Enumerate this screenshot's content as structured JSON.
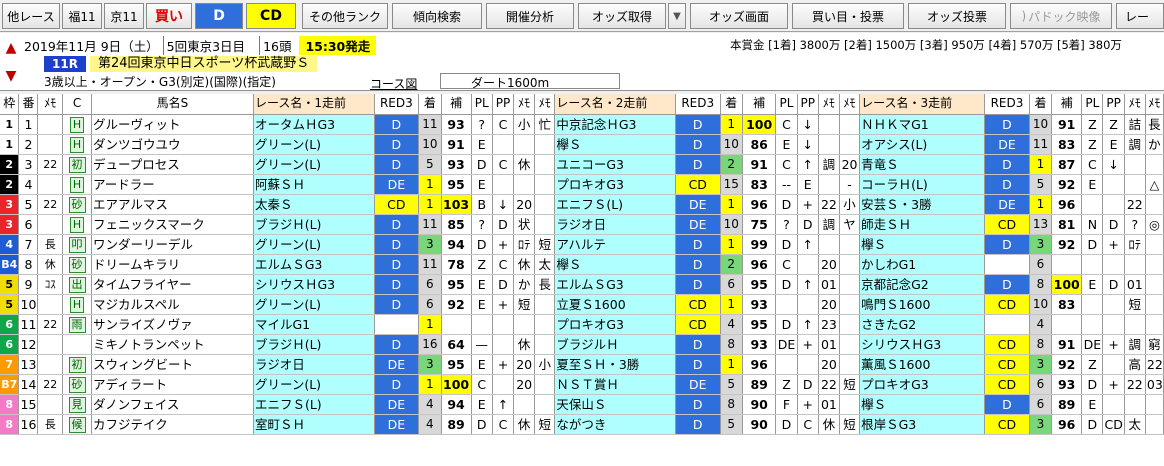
{
  "toolbar": {
    "items": [
      {
        "label": "他レース"
      },
      {
        "label": "福11"
      },
      {
        "label": "京11"
      },
      {
        "label": "買い"
      },
      {
        "label": "D"
      },
      {
        "label": "CD"
      },
      {
        "label": "その他ランク"
      },
      {
        "label": "傾向検索"
      },
      {
        "label": "開催分析"
      },
      {
        "label": "オッズ取得"
      },
      {
        "label": "▼"
      },
      {
        "label": "オッズ画面"
      },
      {
        "label": "買い目・投票"
      },
      {
        "label": "オッズ投票"
      },
      {
        "label": "パドック映像"
      },
      {
        "label": "レー"
      }
    ]
  },
  "race": {
    "date": "2019年11月 9日（土）",
    "meeting": "5回東京3日目",
    "heads": "16頭",
    "start": "15:30発走",
    "number": "11R",
    "title": "第24回東京中日スポーツ杯武蔵野Ｓ",
    "conditions": "3歳以上・オープン・G3(別定)(国際)(指定)",
    "course_label": "コース図",
    "course": "ダート1600m",
    "prize": "本賞金 [1着] 3800万 [2着] 1500万 [3着] 950万 [4着] 570万 [5着] 380万"
  },
  "headers": [
    "枠",
    "番",
    "ﾒﾓ",
    "C",
    "馬名S",
    "レース名・1走前",
    "RED3",
    "着",
    "補",
    "PL",
    "PP",
    "ﾒﾓ",
    "ﾒﾓ",
    "レース名・2走前",
    "RED3",
    "着",
    "補",
    "PL",
    "PP",
    "ﾒﾓ",
    "ﾒﾓ",
    "レース名・3走前",
    "RED3",
    "着",
    "補",
    "PL",
    "PP",
    "ﾒﾓ",
    "ﾒﾓ"
  ],
  "horses": [
    {
      "waku": "1",
      "ban": "1",
      "memo": "",
      "c": "H",
      "name": "グルーヴィット",
      "r1": "オータムＨG3",
      "d1": "D",
      "p1": "11",
      "t1": "93",
      "l1": "?",
      "m1": "C",
      "n1": "小",
      "o1": "忙",
      "r2": "中京記念ＨG3",
      "d2": "D",
      "p2": "1",
      "t2": "100",
      "l2": "C",
      "m2": "↓",
      "n2": "",
      "o2": "",
      "r3": "ＮＨＫマG1",
      "d3": "D",
      "p3": "10",
      "t3": "91",
      "l3": "Z",
      "m3": "Z",
      "n3": "詰",
      "o3": "長"
    },
    {
      "waku": "1",
      "ban": "2",
      "memo": "",
      "c": "H",
      "name": "ダンツゴウユウ",
      "r1": "グリーン(L)",
      "d1": "D",
      "p1": "10",
      "t1": "91",
      "l1": "E",
      "m1": "",
      "n1": "",
      "o1": "",
      "r2": "欅Ｓ",
      "d2": "D",
      "p2": "10",
      "t2": "86",
      "l2": "E",
      "m2": "↓",
      "n2": "",
      "o2": "",
      "r3": "オアシス(L)",
      "d3": "DE",
      "p3": "11",
      "t3": "83",
      "l3": "Z",
      "m3": "E",
      "n3": "調",
      "o3": "か"
    },
    {
      "waku": "2",
      "ban": "3",
      "memo": "22",
      "c": "初",
      "name": "デュープロセス",
      "r1": "グリーン(L)",
      "d1": "D",
      "p1": "5",
      "t1": "93",
      "l1": "D",
      "m1": "C",
      "n1": "休",
      "o1": "",
      "r2": "ユニコーG3",
      "d2": "D",
      "p2": "2",
      "t2": "91",
      "l2": "C",
      "m2": "↑",
      "n2": "調",
      "o2": "20",
      "r3": "青竜Ｓ",
      "d3": "D",
      "p3": "1",
      "t3": "87",
      "l3": "C",
      "m3": "↓",
      "n3": "",
      "o3": ""
    },
    {
      "waku": "2",
      "ban": "4",
      "memo": "",
      "c": "H",
      "name": "アードラー",
      "r1": "阿蘇ＳＨ",
      "d1": "DE",
      "p1": "1",
      "t1": "95",
      "l1": "E",
      "m1": "",
      "n1": "",
      "o1": "",
      "r2": "プロキオG3",
      "d2": "CD",
      "p2": "15",
      "t2": "83",
      "l2": "--",
      "m2": "E",
      "n2": "",
      "o2": "-",
      "r3": "コーラＨ(L)",
      "d3": "D",
      "p3": "5",
      "t3": "92",
      "l3": "E",
      "m3": "",
      "n3": "",
      "o3": "△"
    },
    {
      "waku": "3",
      "ban": "5",
      "memo": "22",
      "c": "砂",
      "name": "エアアルマス",
      "r1": "太秦Ｓ",
      "d1": "CD",
      "p1": "1",
      "t1": "103",
      "l1": "B",
      "m1": "↓",
      "n1": "20",
      "o1": "",
      "r2": "エニフＳ(L)",
      "d2": "DE",
      "p2": "1",
      "t2": "96",
      "l2": "D",
      "m2": "+",
      "n2": "22",
      "o2": "小",
      "r3": "安芸Ｓ・3勝",
      "d3": "DE",
      "p3": "1",
      "t3": "96",
      "l3": "",
      "m3": "",
      "n3": "22",
      "o3": ""
    },
    {
      "waku": "3",
      "ban": "6",
      "memo": "",
      "c": "H",
      "name": "フェニックスマーク",
      "r1": "ブラジＨ(L)",
      "d1": "D",
      "p1": "11",
      "t1": "85",
      "l1": "?",
      "m1": "D",
      "n1": "状",
      "o1": "",
      "r2": "ラジオ日",
      "d2": "DE",
      "p2": "10",
      "t2": "75",
      "l2": "?",
      "m2": "D",
      "n2": "調",
      "o2": "ヤ",
      "r3": "師走ＳＨ",
      "d3": "CD",
      "p3": "13",
      "t3": "81",
      "l3": "N",
      "m3": "D",
      "n3": "?",
      "o3": "◎"
    },
    {
      "waku": "4",
      "ban": "7",
      "memo": "長",
      "c": "叩",
      "name": "ワンダーリーデル",
      "r1": "グリーン(L)",
      "d1": "D",
      "p1": "3",
      "t1": "94",
      "l1": "D",
      "m1": "+",
      "n1": "ﾛﾃ",
      "o1": "短",
      "r2": "アハルテ",
      "d2": "D",
      "p2": "1",
      "t2": "99",
      "l2": "D",
      "m2": "↑",
      "n2": "",
      "o2": "",
      "r3": "欅Ｓ",
      "d3": "D",
      "p3": "3",
      "t3": "92",
      "l3": "D",
      "m3": "+",
      "n3": "ﾛﾃ",
      "o3": ""
    },
    {
      "waku": "B4",
      "ban": "8",
      "memo": "休",
      "c": "砂",
      "name": "ドリームキラリ",
      "r1": "エルムＳG3",
      "d1": "D",
      "p1": "11",
      "t1": "78",
      "l1": "Z",
      "m1": "C",
      "n1": "休",
      "o1": "太",
      "r2": "欅Ｓ",
      "d2": "D",
      "p2": "2",
      "t2": "96",
      "l2": "C",
      "m2": "",
      "n2": "20",
      "o2": "",
      "r3": "かしわG1",
      "d3": "",
      "p3": "6",
      "t3": "",
      "l3": "",
      "m3": "",
      "n3": "",
      "o3": ""
    },
    {
      "waku": "5",
      "ban": "9",
      "memo": "ｺｽ",
      "c": "出",
      "name": "タイムフライヤー",
      "r1": "シリウスＨG3",
      "d1": "D",
      "p1": "6",
      "t1": "95",
      "l1": "E",
      "m1": "D",
      "n1": "か",
      "o1": "長",
      "r2": "エルムＳG3",
      "d2": "D",
      "p2": "6",
      "t2": "95",
      "l2": "D",
      "m2": "↑",
      "n2": "01",
      "o2": "",
      "r3": "京都記念G2",
      "d3": "D",
      "p3": "8",
      "t3": "100",
      "l3": "E",
      "m3": "D",
      "n3": "01",
      "o3": ""
    },
    {
      "waku": "5",
      "ban": "10",
      "memo": "",
      "c": "H",
      "name": "マジカルスペル",
      "r1": "グリーン(L)",
      "d1": "D",
      "p1": "6",
      "t1": "92",
      "l1": "E",
      "m1": "+",
      "n1": "短",
      "o1": "",
      "r2": "立夏Ｓ1600",
      "d2": "CD",
      "p2": "1",
      "t2": "93",
      "l2": "",
      "m2": "",
      "n2": "20",
      "o2": "",
      "r3": "鳴門Ｓ1600",
      "d3": "CD",
      "p3": "10",
      "t3": "83",
      "l3": "",
      "m3": "",
      "n3": "短",
      "o3": ""
    },
    {
      "waku": "6",
      "ban": "11",
      "memo": "22",
      "c": "雨",
      "name": "サンライズノヴァ",
      "r1": "マイルG1",
      "d1": "",
      "p1": "1",
      "t1": "",
      "l1": "",
      "m1": "",
      "n1": "",
      "o1": "",
      "r2": "プロキオG3",
      "d2": "CD",
      "p2": "4",
      "t2": "95",
      "l2": "D",
      "m2": "↑",
      "n2": "23",
      "o2": "",
      "r3": "さきたG2",
      "d3": "",
      "p3": "4",
      "t3": "",
      "l3": "",
      "m3": "",
      "n3": "",
      "o3": ""
    },
    {
      "waku": "6",
      "ban": "12",
      "memo": "",
      "c": "",
      "name": "ミキノトランペット",
      "r1": "ブラジＨ(L)",
      "d1": "D",
      "p1": "16",
      "t1": "64",
      "l1": "—",
      "m1": "",
      "n1": "休",
      "o1": "",
      "r2": "ブラジルＨ",
      "d2": "D",
      "p2": "8",
      "t2": "93",
      "l2": "DE",
      "m2": "+",
      "n2": "01",
      "o2": "",
      "r3": "シリウスＨG3",
      "d3": "CD",
      "p3": "8",
      "t3": "91",
      "l3": "DE",
      "m3": "+",
      "n3": "調",
      "o3": "窮"
    },
    {
      "waku": "7",
      "ban": "13",
      "memo": "",
      "c": "初",
      "name": "スウィングビート",
      "r1": "ラジオ日",
      "d1": "DE",
      "p1": "3",
      "t1": "95",
      "l1": "E",
      "m1": "+",
      "n1": "20",
      "o1": "小",
      "r2": "夏至ＳＨ・3勝",
      "d2": "D",
      "p2": "1",
      "t2": "96",
      "l2": "",
      "m2": "",
      "n2": "20",
      "o2": "",
      "r3": "薫風Ｓ1600",
      "d3": "CD",
      "p3": "3",
      "t3": "92",
      "l3": "Z",
      "m3": "",
      "n3": "高",
      "o3": "22"
    },
    {
      "waku": "B7",
      "ban": "14",
      "memo": "22",
      "c": "砂",
      "name": "アディラート",
      "r1": "グリーン(L)",
      "d1": "D",
      "p1": "1",
      "t1": "100",
      "l1": "C",
      "m1": "",
      "n1": "20",
      "o1": "",
      "r2": "ＮＳＴ賞Ｈ",
      "d2": "DE",
      "p2": "5",
      "t2": "89",
      "l2": "Z",
      "m2": "D",
      "n2": "22",
      "o2": "短",
      "r3": "プロキオG3",
      "d3": "CD",
      "p3": "6",
      "t3": "93",
      "l3": "D",
      "m3": "+",
      "n3": "22",
      "o3": "03"
    },
    {
      "waku": "8",
      "ban": "15",
      "memo": "",
      "c": "見",
      "name": "ダノンフェイス",
      "r1": "エニフＳ(L)",
      "d1": "DE",
      "p1": "4",
      "t1": "94",
      "l1": "E",
      "m1": "↑",
      "n1": "",
      "o1": "",
      "r2": "天保山Ｓ",
      "d2": "D",
      "p2": "8",
      "t2": "90",
      "l2": "F",
      "m2": "+",
      "n2": "01",
      "o2": "",
      "r3": "欅Ｓ",
      "d3": "D",
      "p3": "6",
      "t3": "89",
      "l3": "E",
      "m3": "",
      "n3": "",
      "o3": ""
    },
    {
      "waku": "8",
      "ban": "16",
      "memo": "長",
      "c": "候",
      "name": "カフジテイク",
      "r1": "室町ＳＨ",
      "d1": "DE",
      "p1": "4",
      "t1": "89",
      "l1": "D",
      "m1": "C",
      "n1": "休",
      "o1": "短",
      "r2": "ながつき",
      "d2": "D",
      "p2": "5",
      "t2": "90",
      "l2": "D",
      "m2": "C",
      "n2": "休",
      "o2": "短",
      "r3": "根岸ＳG3",
      "d3": "CD",
      "p3": "3",
      "t3": "96",
      "l3": "D",
      "m3": "CD",
      "n3": "太",
      "o3": ""
    }
  ],
  "colors": {
    "waku1": "#ffffff",
    "waku2": "#000000",
    "waku3": "#e8262a",
    "waku4": "#1e5cd6",
    "wakuB4": "#1e5cd6",
    "waku5": "#f2dd00",
    "waku6": "#11a54a",
    "waku7": "#ff9900",
    "wakuB7": "#ff9900",
    "waku8": "#f37ac5",
    "race": "#b0ffff",
    "dBlue": "#2f6fdc",
    "dYellow": "#ffff00"
  }
}
